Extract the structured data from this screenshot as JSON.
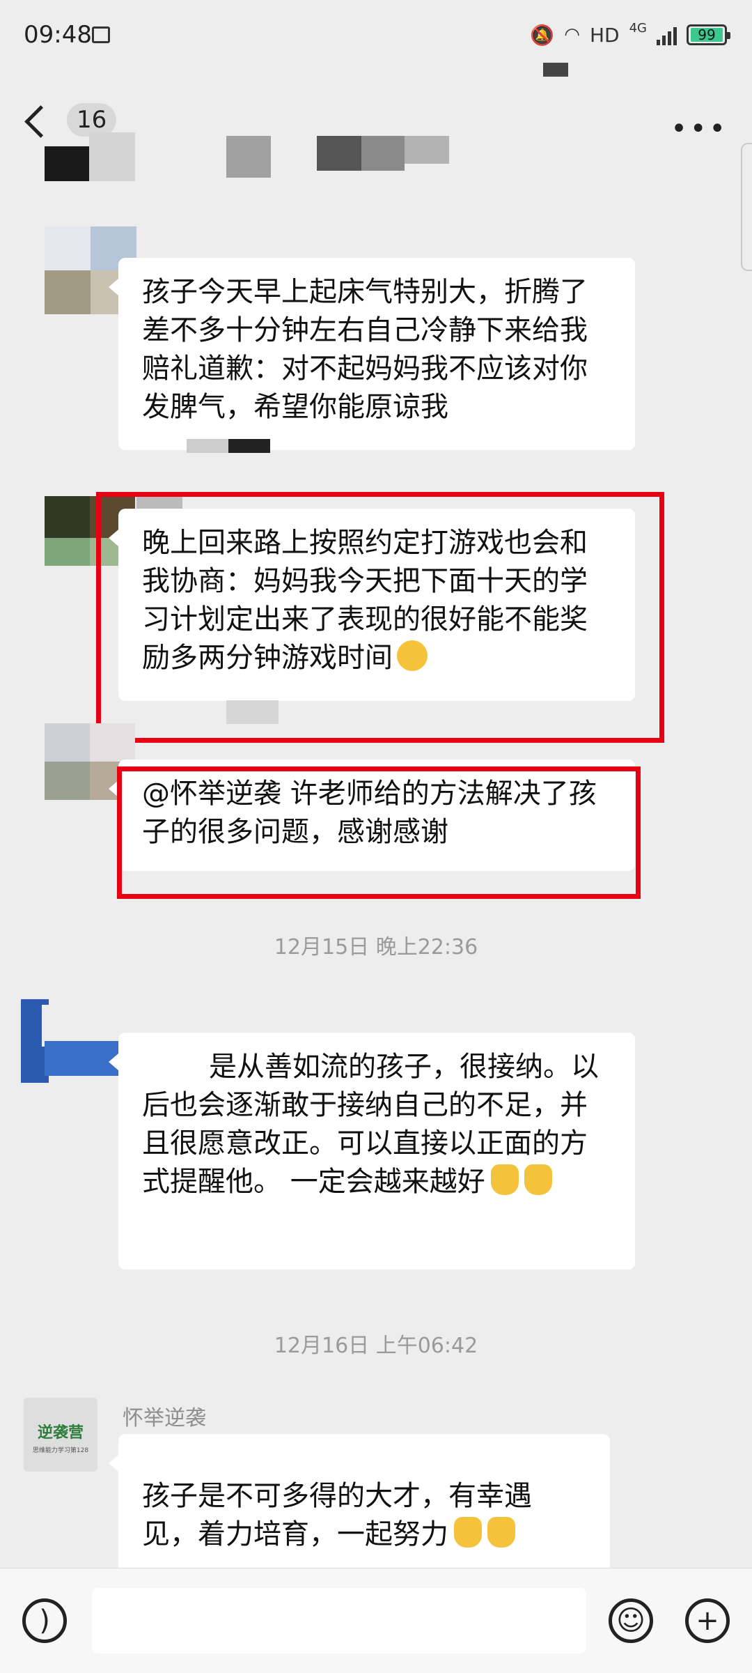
{
  "status_bar": {
    "time": "09:48",
    "hd": "HD",
    "network": "4G",
    "battery": "99"
  },
  "nav": {
    "unread_count": "16",
    "more": "•••"
  },
  "timestamps": [
    "12月15日 晚上22:36",
    "12月16日 上午06:42"
  ],
  "messages": [
    {
      "text": "孩子今天早上起床气特别大，折腾了差不多十分钟左右自己冷静下来给我赔礼道歉：对不起妈妈我不应该对你发脾气，希望你能原谅我"
    },
    {
      "text": "晚上回来路上按照约定打游戏也会和我协商：妈妈我今天把下面十天的学习计划定出来了表现的很好能不能奖励多两分钟游戏时间"
    },
    {
      "text": "@怀举逆袭  许老师给的方法解决了孩子的很多问题，感谢感谢"
    },
    {
      "text": "是从善如流的孩子，很接纳。以后也会逐渐敢于接纳自己的不足，并且很愿意改正。可以直接以正面的方式提醒他。        一定会越来越好"
    },
    {
      "sender": "怀举逆袭",
      "text": "孩子是不可多得的大才，有幸遇见，着力培育，一起努力"
    }
  ],
  "avatar_logo": {
    "title": "逆袭营",
    "subtitle": "思维能力学习第128"
  }
}
